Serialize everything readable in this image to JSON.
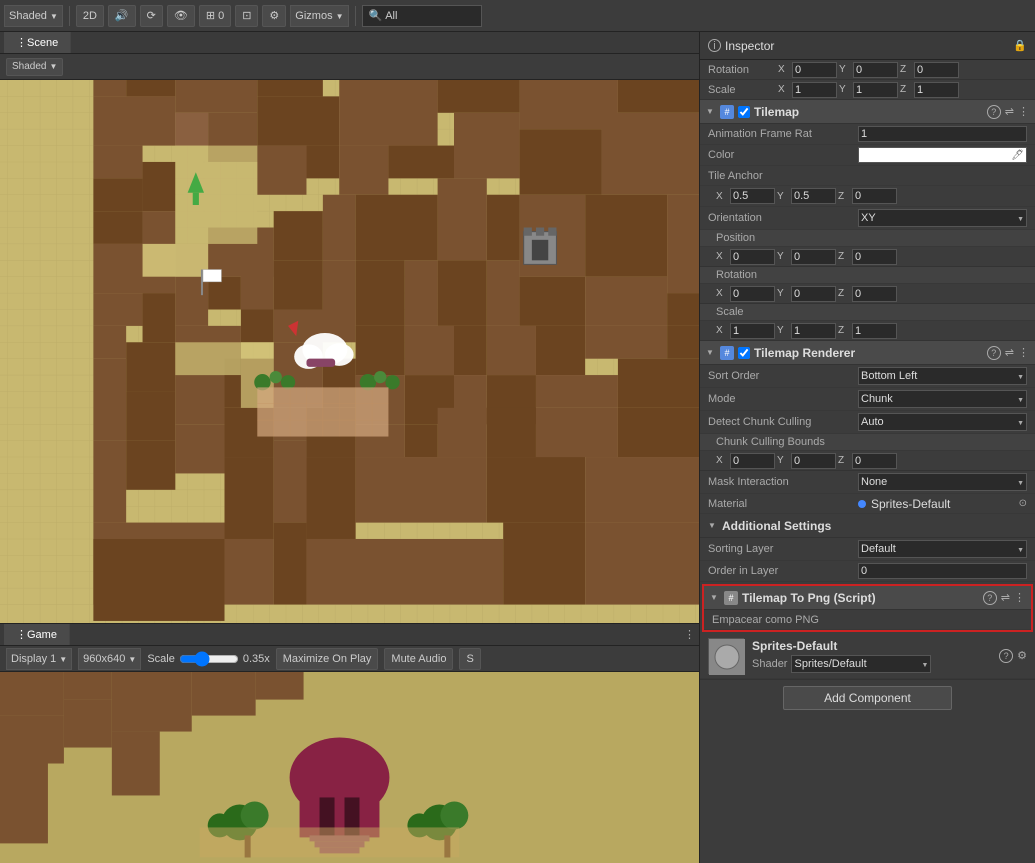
{
  "topToolbar": {
    "shading": "Shaded",
    "2d_label": "2D",
    "gizmos": "Gizmos",
    "all_label": "All",
    "search_placeholder": "All"
  },
  "sceneTabs": {
    "scene_label": "Scene",
    "game_label": "Game"
  },
  "sceneToolbar": {
    "shaded_label": "Shaded"
  },
  "inspector": {
    "title": "Inspector",
    "lock_icon": "🔒",
    "transform": {
      "rotation_label": "Rotation",
      "rotation_x": "0",
      "rotation_y": "0",
      "rotation_z": "0",
      "scale_label": "Scale",
      "scale_x": "1",
      "scale_y": "1",
      "scale_z": "1"
    },
    "tilemap": {
      "component_label": "Tilemap",
      "anim_frame_rate_label": "Animation Frame Rat",
      "anim_frame_rate_val": "1",
      "color_label": "Color",
      "tile_anchor_label": "Tile Anchor",
      "tile_anchor_x": "0.5",
      "tile_anchor_y": "0.5",
      "tile_anchor_z": "0",
      "orientation_label": "Orientation",
      "orientation_val": "XY",
      "position_label": "Position",
      "pos_x": "0",
      "pos_y": "0",
      "pos_z": "0",
      "rotation_label": "Rotation",
      "rot_x": "0",
      "rot_y": "0",
      "rot_z": "0",
      "scale_label": "Scale",
      "sc_x": "1",
      "sc_y": "1",
      "sc_z": "1"
    },
    "tilemapRenderer": {
      "component_label": "Tilemap Renderer",
      "sort_order_label": "Sort Order",
      "sort_order_val": "Bottom Left",
      "mode_label": "Mode",
      "mode_val": "Chunk",
      "detect_chunk_label": "Detect Chunk Culling",
      "detect_chunk_val": "Auto",
      "chunk_bounds_label": "Chunk Culling Bounds",
      "bounds_x": "0",
      "bounds_y": "0",
      "bounds_z": "0",
      "mask_interaction_label": "Mask Interaction",
      "mask_interaction_val": "None",
      "material_label": "Material",
      "material_val": "Sprites-Default"
    },
    "additionalSettings": {
      "label": "Additional Settings",
      "sorting_layer_label": "Sorting Layer",
      "sorting_layer_val": "Default",
      "order_in_layer_label": "Order in Layer",
      "order_in_layer_val": "0"
    },
    "tilemapScript": {
      "label": "Tilemap To Png (Script)",
      "sub_label": "Empacear como PNG"
    },
    "spritesDefault": {
      "name": "Sprites-Default",
      "shader_label": "Shader",
      "shader_val": "Sprites/Default"
    },
    "addComponentLabel": "Add Component"
  },
  "gameToolbar": {
    "display_label": "Display 1",
    "resolution_label": "960x640",
    "scale_label": "Scale",
    "scale_val": "0.35x",
    "maximize_label": "Maximize On Play",
    "mute_label": "Mute Audio",
    "stats_label": "S"
  }
}
